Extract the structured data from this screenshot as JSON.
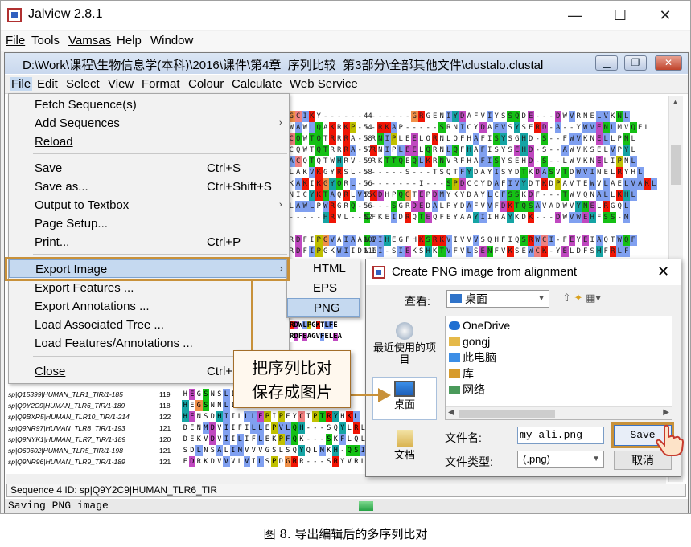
{
  "app": {
    "title": "Jalview 2.8.1",
    "controls": {
      "minimize": "—",
      "maximize": "☐",
      "close": "✕"
    },
    "menu": [
      "File",
      "Tools",
      "Vamsas",
      "Help",
      "Window"
    ]
  },
  "doc": {
    "title": "D:\\Work\\课程\\生物信息学(本科)\\2016\\课件\\第4章_序列比较_第3部分\\全部其他文件\\clustalo.clustal",
    "menu": [
      "File",
      "Edit",
      "Select",
      "View",
      "Format",
      "Colour",
      "Calculate",
      "Web Service"
    ]
  },
  "file_menu": {
    "items": [
      {
        "label": "Fetch Sequence(s)",
        "shortcut": "",
        "arrow": ""
      },
      {
        "label": "Add Sequences",
        "shortcut": "",
        "arrow": "›"
      },
      {
        "label": "Reload",
        "shortcut": "",
        "arrow": ""
      },
      {
        "label": "Save",
        "shortcut": "Ctrl+S",
        "arrow": ""
      },
      {
        "label": "Save as...",
        "shortcut": "Ctrl+Shift+S",
        "arrow": ""
      },
      {
        "label": "Output to Textbox",
        "shortcut": "",
        "arrow": "›"
      },
      {
        "label": "Page Setup...",
        "shortcut": "",
        "arrow": ""
      },
      {
        "label": "Print...",
        "shortcut": "Ctrl+P",
        "arrow": ""
      },
      {
        "label": "Export Image",
        "shortcut": "",
        "arrow": "›"
      },
      {
        "label": "Export Features ...",
        "shortcut": "",
        "arrow": ""
      },
      {
        "label": "Export Annotations ...",
        "shortcut": "",
        "arrow": ""
      },
      {
        "label": "Load Associated Tree ...",
        "shortcut": "",
        "arrow": ""
      },
      {
        "label": "Load Features/Annotations ...",
        "shortcut": "",
        "arrow": ""
      },
      {
        "label": "Close",
        "shortcut": "Ctrl+",
        "arrow": ""
      }
    ]
  },
  "export_submenu": {
    "items": [
      "HTML",
      "EPS",
      "PNG"
    ]
  },
  "alignment": {
    "top_lines": [
      "GCIKY-------------GRGENIYDAFVIYSSQDE---DWVRNELVKNL",
      "WAWLQAKRKP---RKAP-----SRNICYDAFVSYSERD-A--YWVENLMVQEL",
      "CQWTQTRRRA--RNIPLEELQRNLQFHAFISYSGHD-S--FWVKNELLPNL",
      "CQWTQTRRRA--RNIPLEELQRNLQFHAFISYSEHD-S--AWVKSELVPYL",
      "ACQTQTWHRV--RKTTQEQLKRNVRFHAFISYSEHD-S--LWVKNELIPNL",
      "LAKVKGYRSL-------S---TSQTFYDAYISYDTKDASVTDWVINELRYHL",
      "KAKIKGYQRL---------I---SPDCCYDAFIVYDTKDPAVTEWVLAELVAKL",
      "NICYKTAQRLVFKDHPQGTEPDMYKYDAYLCFSSKDF---TWVQNALLKHL",
      "LAWLPWRGRQ-----SGRDEDALPYDAFVVFDKTQSAVADWVYNELRGQL",
      "-----HRVL--QFKEIDRQTEQFEYAAYIIHAYKDK---DWVWEHFSS-M"
    ],
    "top_nums": [
      "44",
      "54",
      "58",
      "57",
      "59",
      "58",
      "56",
      "55",
      "56",
      "52"
    ],
    "mid_lines": [
      "RDFIPGVAIAANIIHEGFHKSRKVIVVVSQHFIQSRWCI-FEYEIAQTWQF",
      "RDFIPGKWIIDNII-SIEKSHKTVFVLSENFVKSEWCK-YELDFSHFRLF"
    ],
    "mid_nums": [
      "107",
      "116"
    ],
    "peek_lines": [
      "RDWLPGKTLFE",
      "RDFEAGVFELEA"
    ],
    "bottom_rows": [
      {
        "name": "sp|Q15399|HUMAN_TLR1_TIR/1-185",
        "num": "119",
        "seq": "HEGSNSLIL"
      },
      {
        "name": "sp|Q9Y2C9|HUMAN_TLR6_TIR/1-189",
        "num": "118",
        "seq": "HEGSNNLIL"
      },
      {
        "name": "sp|Q9BXR5|HUMAN_TLR10_TIR/1-214",
        "num": "122",
        "HSEQ": "",
        "seq": "HENSDHIILLLEPIPFYCIPTRYHKL"
      },
      {
        "name": "sp|Q9NR97|HUMAN_TLR8_TIR/1-193",
        "num": "121",
        "seq": "DENMDVIIFILLEPVLQH---SQYLRL"
      },
      {
        "name": "sp|Q9NYK1|HUMAN_TLR7_TIR/1-189",
        "num": "120",
        "seq": "DEKVDVIILIFLEKPFQK---SKFLQL"
      },
      {
        "name": "sp|O60602|HUMAN_TLR5_TIR/1-198",
        "num": "121",
        "seq": "SDLNSALIMVVVGSLSQYQLMKH-QSI"
      },
      {
        "name": "sp|Q9NR96|HUMAN_TLR9_TIR/1-189",
        "num": "121",
        "seq": "EDRKDVVVLVILSPDGRR---SRYVRL"
      }
    ]
  },
  "status": {
    "sequence_info": "Sequence 4 ID: sp|Q9Y2C9|HUMAN_TLR6_TIR",
    "saving": "Saving PNG image"
  },
  "dialog": {
    "title": "Create PNG image from alignment",
    "close": "✕",
    "look_in_label": "查看:",
    "look_in_value": "桌面",
    "places": [
      "最近使用的项目",
      "桌面",
      "文档"
    ],
    "files": [
      "OneDrive",
      "gongj",
      "此电脑",
      "库",
      "网络"
    ],
    "filename_label": "文件名:",
    "filename_value": "my_ali.png",
    "filetype_label": "文件类型:",
    "filetype_value": "(.png)",
    "save_label": "Save",
    "cancel_label": "取消"
  },
  "annotation": {
    "callout_line1": "把序列比对",
    "callout_line2": "保存成图片",
    "accent": "#c8913a"
  },
  "caption": "图 8. 导出编辑后的多序列比对"
}
